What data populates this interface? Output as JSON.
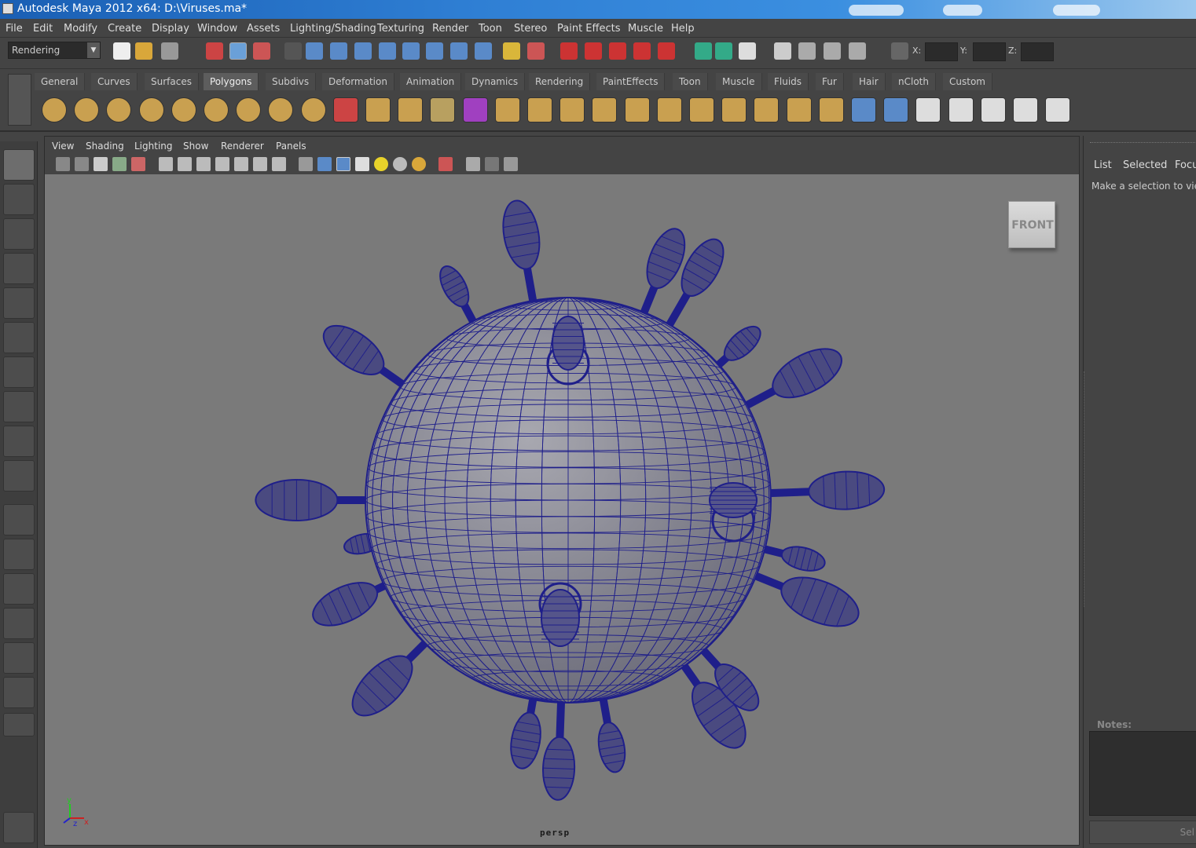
{
  "window": {
    "title": "Autodesk Maya 2012 x64: D:\\Viruses.ma*"
  },
  "menubar": [
    "File",
    "Edit",
    "Modify",
    "Create",
    "Display",
    "Window",
    "Assets",
    "Lighting/Shading",
    "Texturing",
    "Render",
    "Toon",
    "Stereo",
    "Paint Effects",
    "Muscle",
    "Help"
  ],
  "statusline": {
    "mode": "Rendering",
    "coords": {
      "x_label": "X:",
      "y_label": "Y:",
      "z_label": "Z:"
    }
  },
  "shelf": {
    "tabs": [
      "General",
      "Curves",
      "Surfaces",
      "Polygons",
      "Subdivs",
      "Deformation",
      "Animation",
      "Dynamics",
      "Rendering",
      "PaintEffects",
      "Toon",
      "Muscle",
      "Fluids",
      "Fur",
      "Hair",
      "nCloth",
      "Custom"
    ],
    "active_tab": "Polygons",
    "icons": [
      "poly-sphere-icon",
      "poly-cube-icon",
      "poly-cylinder-icon",
      "poly-cone-icon",
      "poly-plane-icon",
      "poly-torus-icon",
      "poly-pyramid-icon",
      "poly-pipe-icon",
      "poly-soccer-ball-icon",
      "separate-icon",
      "combine-icon",
      "smooth-icon",
      "average-vertices-icon",
      "purple-cube-icon",
      "extrude-icon",
      "bridge-icon",
      "append-polygon-icon",
      "split-polygon-icon",
      "insert-edge-loop-icon",
      "offset-edge-loop-icon",
      "chamfer-icon",
      "merge-icon",
      "collapse-icon",
      "duplicate-face-icon",
      "extract-icon",
      "planar-map-icon",
      "cylindrical-map-icon",
      "spherical-map-icon",
      "automatic-map-icon",
      "create-uvs-icon",
      "checker-uv-icon",
      "checker-transform-icon"
    ]
  },
  "panel": {
    "menus": [
      "View",
      "Shading",
      "Lighting",
      "Show",
      "Renderer",
      "Panels"
    ],
    "viewcube_label": "FRONT",
    "camera": "persp",
    "axis": {
      "y": "y",
      "x": "x",
      "z": "z"
    }
  },
  "right_panel": {
    "tabs": [
      "List",
      "Selected",
      "Focu"
    ],
    "message": "Make a selection to view",
    "notes_label": "Notes:",
    "button_label": "Sel"
  },
  "colors": {
    "viewport_bg": "#7a7a7a",
    "wireframe": "#1f1f8a",
    "mesh_shade": "#8f8f9a"
  }
}
